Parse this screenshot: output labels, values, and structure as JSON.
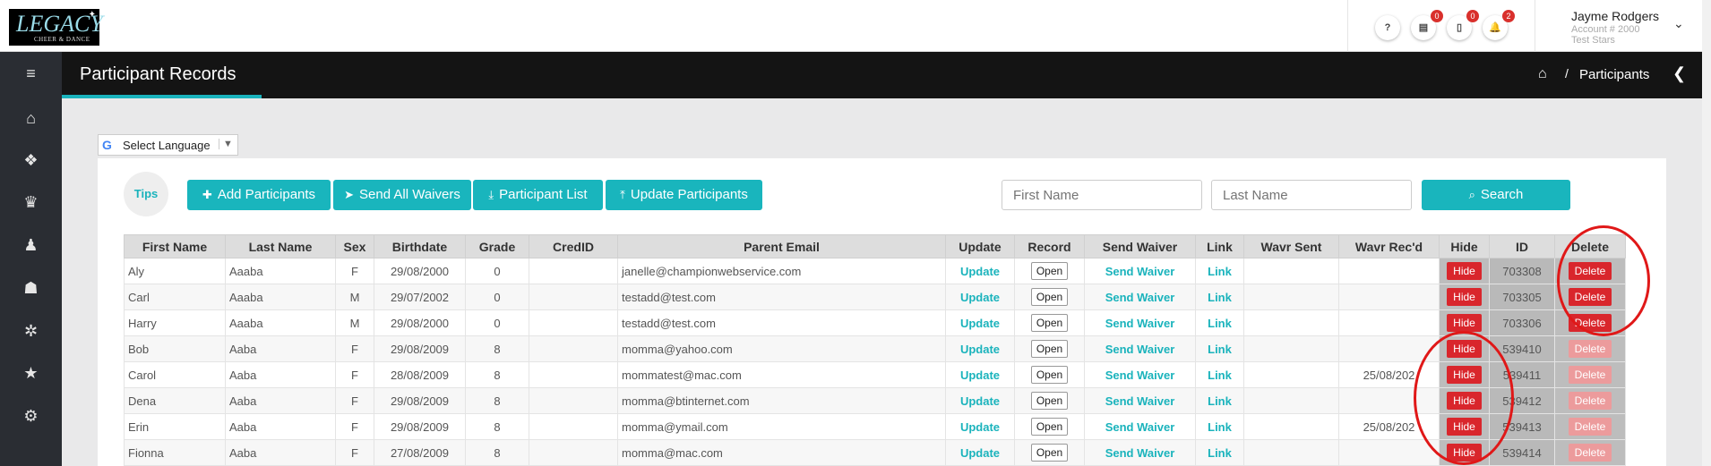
{
  "logo": {
    "text": "LEGACY",
    "subtext": "CHEER & DANCE"
  },
  "header": {
    "help_label": "?",
    "badges": {
      "cards": "0",
      "documents": "0",
      "notifications": "2"
    },
    "user": {
      "name": "Jayme Rodgers",
      "account": "Account # 2000",
      "team": "Test Stars"
    }
  },
  "title_bar": {
    "title": "Participant Records",
    "breadcrumb": "Participants"
  },
  "language": {
    "label": "Select Language"
  },
  "toolbar": {
    "tips": "Tips",
    "add": "Add Participants",
    "send_all": "Send All Waivers",
    "list": "Participant List",
    "update": "Update Participants",
    "first_name_placeholder": "First Name",
    "last_name_placeholder": "Last Name",
    "search": "Search"
  },
  "table": {
    "headers": [
      "First Name",
      "Last Name",
      "Sex",
      "Birthdate",
      "Grade",
      "CredID",
      "Parent Email",
      "Update",
      "Record",
      "Send Waiver",
      "Link",
      "Wavr Sent",
      "Wavr Rec'd",
      "Hide",
      "ID",
      "Delete"
    ],
    "action_labels": {
      "update": "Update",
      "open": "Open",
      "send_waiver": "Send Waiver",
      "link": "Link",
      "hide": "Hide",
      "delete": "Delete"
    },
    "rows": [
      {
        "first": "Aly",
        "last": "Aaaba",
        "sex": "F",
        "birth": "29/08/2000",
        "grade": "0",
        "cred": "",
        "email": "janelle@championwebservice.com",
        "sent": "",
        "recd": "",
        "id": "703308"
      },
      {
        "first": "Carl",
        "last": "Aaaba",
        "sex": "M",
        "birth": "29/07/2002",
        "grade": "0",
        "cred": "",
        "email": "testadd@test.com",
        "sent": "",
        "recd": "",
        "id": "703305"
      },
      {
        "first": "Harry",
        "last": "Aaaba",
        "sex": "M",
        "birth": "29/08/2000",
        "grade": "0",
        "cred": "",
        "email": "testadd@test.com",
        "sent": "",
        "recd": "",
        "id": "703306"
      },
      {
        "first": "Bob",
        "last": "Aaba",
        "sex": "F",
        "birth": "29/08/2009",
        "grade": "8",
        "cred": "",
        "email": "momma@yahoo.com",
        "sent": "",
        "recd": "",
        "id": "539410"
      },
      {
        "first": "Carol",
        "last": "Aaba",
        "sex": "F",
        "birth": "28/08/2009",
        "grade": "8",
        "cred": "",
        "email": "mommatest@mac.com",
        "sent": "",
        "recd": "25/08/202",
        "id": "539411"
      },
      {
        "first": "Dena",
        "last": "Aaba",
        "sex": "F",
        "birth": "29/08/2009",
        "grade": "8",
        "cred": "",
        "email": "momma@btinternet.com",
        "sent": "",
        "recd": "",
        "id": "539412"
      },
      {
        "first": "Erin",
        "last": "Aaba",
        "sex": "F",
        "birth": "29/08/2009",
        "grade": "8",
        "cred": "",
        "email": "momma@ymail.com",
        "sent": "",
        "recd": "25/08/202",
        "id": "539413"
      },
      {
        "first": "Fionna",
        "last": "Aaba",
        "sex": "F",
        "birth": "27/08/2009",
        "grade": "8",
        "cred": "",
        "email": "momma@mac.com",
        "sent": "",
        "recd": "",
        "id": "539414"
      }
    ]
  },
  "colors": {
    "accent": "#19b5bd",
    "danger": "#d9262c",
    "sidebar": "#2a2d33",
    "titlebar": "#141414"
  }
}
